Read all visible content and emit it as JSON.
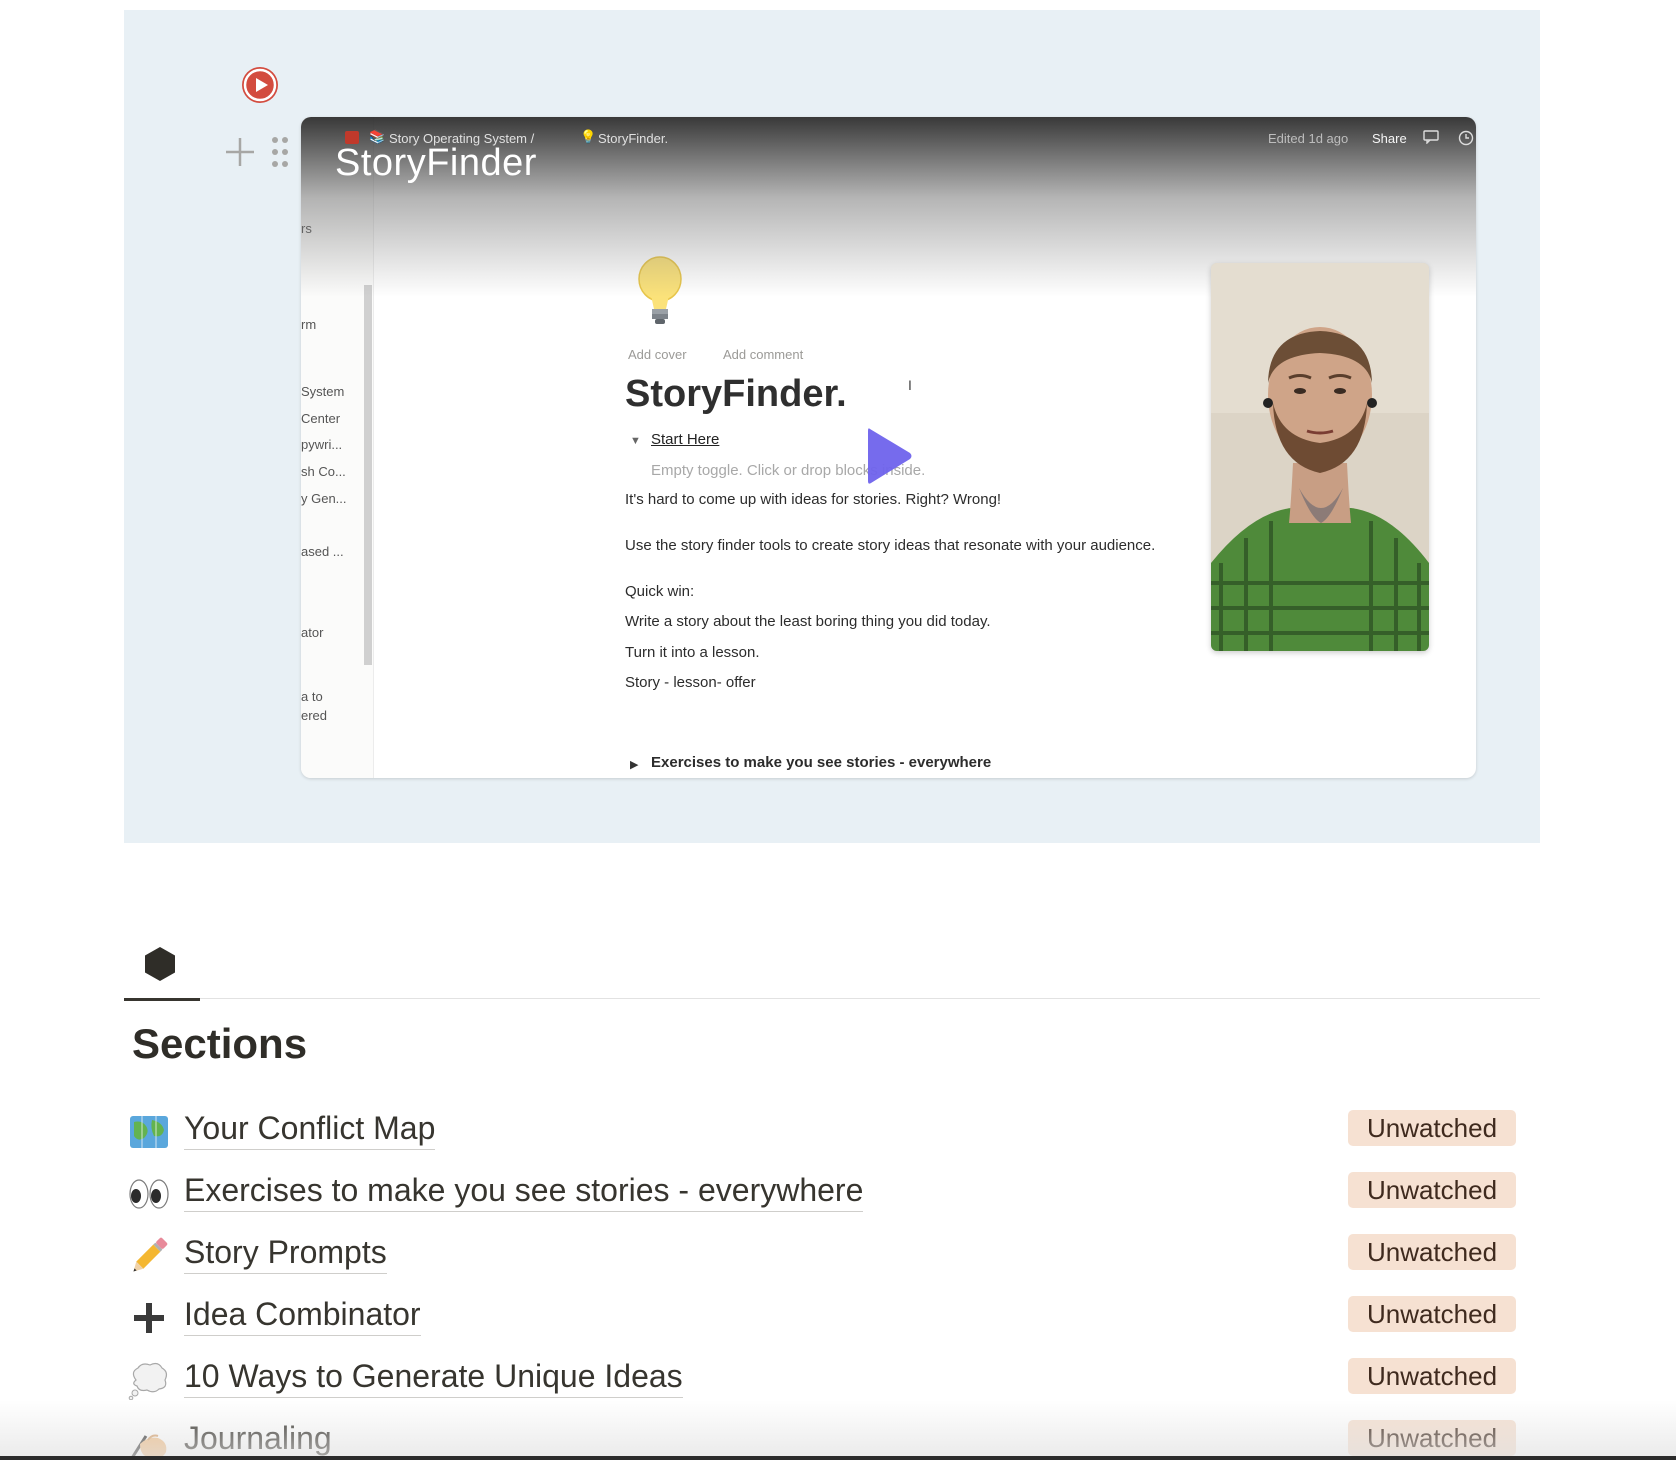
{
  "video": {
    "title": "StoryFinder",
    "notion_page": {
      "breadcrumb": [
        "Story Operating System /",
        "StoryFinder."
      ],
      "edited": "Edited 1d ago",
      "share": "Share",
      "sidebar_items": [
        "rs",
        "rm",
        "System",
        "Center",
        "pywri...",
        "sh Co...",
        "y Gen...",
        "ased ...",
        "ator",
        "a to",
        "ered"
      ],
      "add_cover": "Add cover",
      "add_comment": "Add comment",
      "heading": "StoryFinder.",
      "toggle_label": "Start Here",
      "toggle_empty": "Empty toggle. Click or drop blocks inside.",
      "lines": [
        "It's hard to come up with ideas for stories. Right? Wrong!",
        "Use the story finder tools to create story ideas that resonate with your audience.",
        "Quick win:",
        "Write a story about the least boring thing you did today.",
        "Turn it into a lesson.",
        "Story - lesson- offer"
      ],
      "exercises_toggle": "Exercises to make you see stories - everywhere"
    }
  },
  "sections": {
    "heading": "Sections",
    "items": [
      {
        "icon": "map-icon",
        "title": "Your Conflict Map",
        "status": "Unwatched"
      },
      {
        "icon": "eyes-icon",
        "title": "Exercises to make you see stories - everywhere",
        "status": "Unwatched"
      },
      {
        "icon": "pencil-icon",
        "title": "Story Prompts",
        "status": "Unwatched"
      },
      {
        "icon": "plus-icon",
        "title": "Idea Combinator",
        "status": "Unwatched"
      },
      {
        "icon": "thought-bubble-icon",
        "title": "10 Ways to Generate Unique Ideas",
        "status": "Unwatched"
      },
      {
        "icon": "writing-hand-icon",
        "title": "Journaling",
        "status": "Unwatched"
      }
    ]
  },
  "colors": {
    "block_bg": "#e8f0f5",
    "badge_bg": "#f6e1d2",
    "loom_red": "#d34c3f",
    "play_purple": "#6f63ec"
  }
}
